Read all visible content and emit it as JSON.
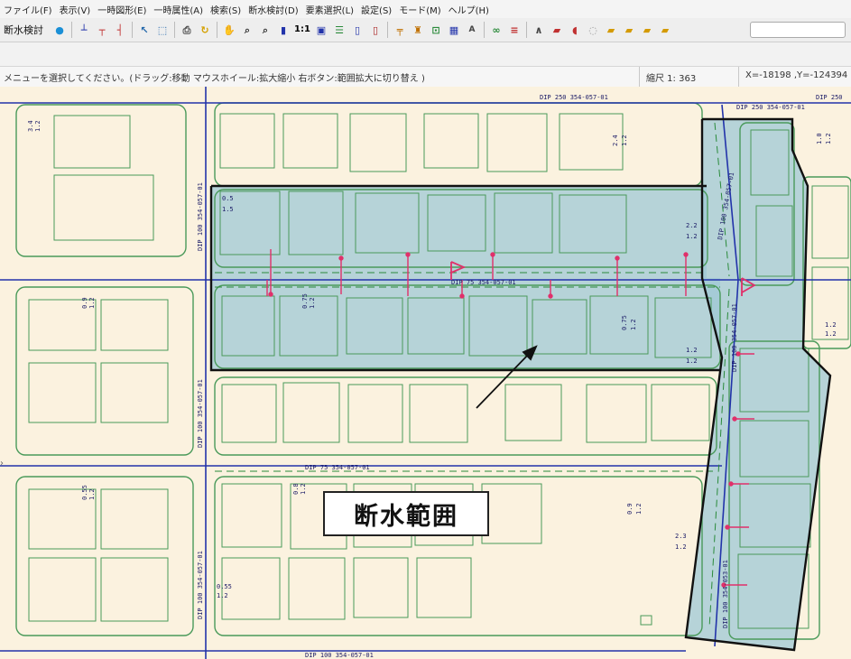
{
  "menu": [
    "ファイル(F)",
    "表示(V)",
    "一時図形(E)",
    "一時属性(A)",
    "検索(S)",
    "断水検討(D)",
    "要素選択(L)",
    "設定(S)",
    "モード(M)",
    "ヘルプ(H)"
  ],
  "toolbar": {
    "mode_label": "断水検討",
    "zoom_ratio_label": "1:1"
  },
  "status": {
    "message": "メニューを選択してください。(ドラッグ:移動 マウスホイール:拡大縮小 右ボタン:範囲拡大に切り替え )",
    "scale": "縮尺 1: 363",
    "coords": "X=-18198 ,Y=-124394"
  },
  "map": {
    "pipe_labels": [
      "DIP 250 354-057-01",
      "DIP 250",
      "DIP 250 354-057-01",
      "DIP 75 354-057-01",
      "DIP 75 354-057-01",
      "DIP 100 354-057-01",
      "DIP 100 354-057-01",
      "DIP 100 354-057-01",
      "DIP 100 354-057-01",
      "DIP 100 354-053-01",
      "DIP 100 354-057-01",
      "DIP 100 354-057-01"
    ],
    "dim_labels": [
      {
        "top": "0.5",
        "bottom": "1.5"
      },
      {
        "top": "2.2",
        "bottom": "1.2"
      },
      {
        "top": "1.0",
        "bottom": "1.2"
      },
      {
        "top": "2.4",
        "bottom": "1.2"
      },
      {
        "top": "0.9",
        "bottom": "1.2"
      },
      {
        "top": "0.75",
        "bottom": "1.2"
      },
      {
        "top": "0.75",
        "bottom": "1.2"
      },
      {
        "top": "1.2",
        "bottom": "1.2"
      },
      {
        "top": "0.55",
        "bottom": "1.2"
      },
      {
        "top": "0.9",
        "bottom": "1.2"
      },
      {
        "top": "2.3",
        "bottom": "1.2"
      },
      {
        "top": "0.8",
        "bottom": "1.2"
      },
      {
        "top": "0.55",
        "bottom": "1.2"
      },
      {
        "top": "3.4",
        "bottom": "1.2"
      },
      {
        "top": "1.2",
        "bottom": "1.2"
      }
    ],
    "annotation": "断水範囲",
    "colors": {
      "background": "#fbf2df",
      "parcel": "#4a9a5a",
      "pipe": "#2233aa",
      "shutoff_fill": "#9fc8d6",
      "shutoff_border": "#111111",
      "service_line": "#e0306a"
    }
  }
}
